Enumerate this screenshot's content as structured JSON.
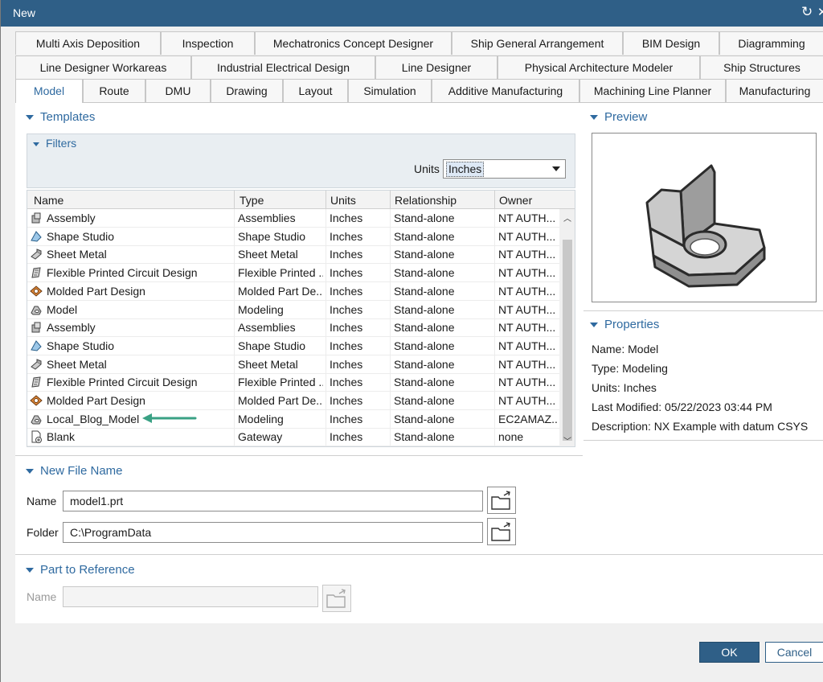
{
  "window": {
    "title": "New"
  },
  "tabs": {
    "row1": [
      "Multi Axis Deposition",
      "Inspection",
      "Mechatronics Concept Designer",
      "Ship General Arrangement",
      "BIM Design",
      "Diagramming"
    ],
    "row2": [
      "Line Designer Workareas",
      "Industrial Electrical Design",
      "Line Designer",
      "Physical Architecture Modeler",
      "Ship Structures"
    ],
    "row3": [
      "Model",
      "Route",
      "DMU",
      "Drawing",
      "Layout",
      "Simulation",
      "Additive Manufacturing",
      "Machining Line Planner",
      "Manufacturing"
    ],
    "active": "Model"
  },
  "templates": {
    "heading": "Templates",
    "filters_heading": "Filters",
    "units_label": "Units",
    "units_value": "Inches",
    "columns": [
      "Name",
      "Type",
      "Units",
      "Relationship",
      "Owner"
    ],
    "rows": [
      {
        "icon": "assembly-icon",
        "name": "Assembly",
        "type": "Assemblies",
        "units": "Inches",
        "relationship": "Stand-alone",
        "owner": "NT AUTH..."
      },
      {
        "icon": "shape-studio-icon",
        "name": "Shape Studio",
        "type": "Shape Studio",
        "units": "Inches",
        "relationship": "Stand-alone",
        "owner": "NT AUTH..."
      },
      {
        "icon": "sheet-metal-icon",
        "name": "Sheet Metal",
        "type": "Sheet Metal",
        "units": "Inches",
        "relationship": "Stand-alone",
        "owner": "NT AUTH..."
      },
      {
        "icon": "flexible-circuit-icon",
        "name": "Flexible Printed Circuit Design",
        "type": "Flexible Printed ...",
        "units": "Inches",
        "relationship": "Stand-alone",
        "owner": "NT AUTH..."
      },
      {
        "icon": "molded-part-icon",
        "name": "Molded Part Design",
        "type": "Molded Part De...",
        "units": "Inches",
        "relationship": "Stand-alone",
        "owner": "NT AUTH..."
      },
      {
        "icon": "model-icon",
        "name": "Model",
        "type": "Modeling",
        "units": "Inches",
        "relationship": "Stand-alone",
        "owner": "NT AUTH..."
      },
      {
        "icon": "assembly-icon",
        "name": "Assembly",
        "type": "Assemblies",
        "units": "Inches",
        "relationship": "Stand-alone",
        "owner": "NT AUTH..."
      },
      {
        "icon": "shape-studio-icon",
        "name": "Shape Studio",
        "type": "Shape Studio",
        "units": "Inches",
        "relationship": "Stand-alone",
        "owner": "NT AUTH..."
      },
      {
        "icon": "sheet-metal-icon",
        "name": "Sheet Metal",
        "type": "Sheet Metal",
        "units": "Inches",
        "relationship": "Stand-alone",
        "owner": "NT AUTH..."
      },
      {
        "icon": "flexible-circuit-icon",
        "name": "Flexible Printed Circuit Design",
        "type": "Flexible Printed ...",
        "units": "Inches",
        "relationship": "Stand-alone",
        "owner": "NT AUTH..."
      },
      {
        "icon": "molded-part-icon",
        "name": "Molded Part Design",
        "type": "Molded Part De...",
        "units": "Inches",
        "relationship": "Stand-alone",
        "owner": "NT AUTH..."
      },
      {
        "icon": "model-icon",
        "name": "Local_Blog_Model",
        "type": "Modeling",
        "units": "Inches",
        "relationship": "Stand-alone",
        "owner": "EC2AMAZ..."
      },
      {
        "icon": "blank-icon",
        "name": "Blank",
        "type": "Gateway",
        "units": "Inches",
        "relationship": "Stand-alone",
        "owner": "none"
      }
    ]
  },
  "preview": {
    "heading": "Preview"
  },
  "properties": {
    "heading": "Properties",
    "name": "Name: Model",
    "type": "Type: Modeling",
    "units": "Units: Inches",
    "modified": "Last Modified: 05/22/2023 03:44 PM",
    "description": "Description: NX Example with datum CSYS"
  },
  "new_file": {
    "heading": "New File Name",
    "name_label": "Name",
    "name_value": "model1.prt",
    "folder_label": "Folder",
    "folder_value": "C:\\ProgramData"
  },
  "part_reference": {
    "heading": "Part to Reference",
    "name_label": "Name",
    "name_value": ""
  },
  "buttons": {
    "ok": "OK",
    "cancel": "Cancel"
  },
  "colors": {
    "titlebar": "#2f5f87",
    "accent": "#2f6aa0",
    "arrow": "#3aa184"
  }
}
